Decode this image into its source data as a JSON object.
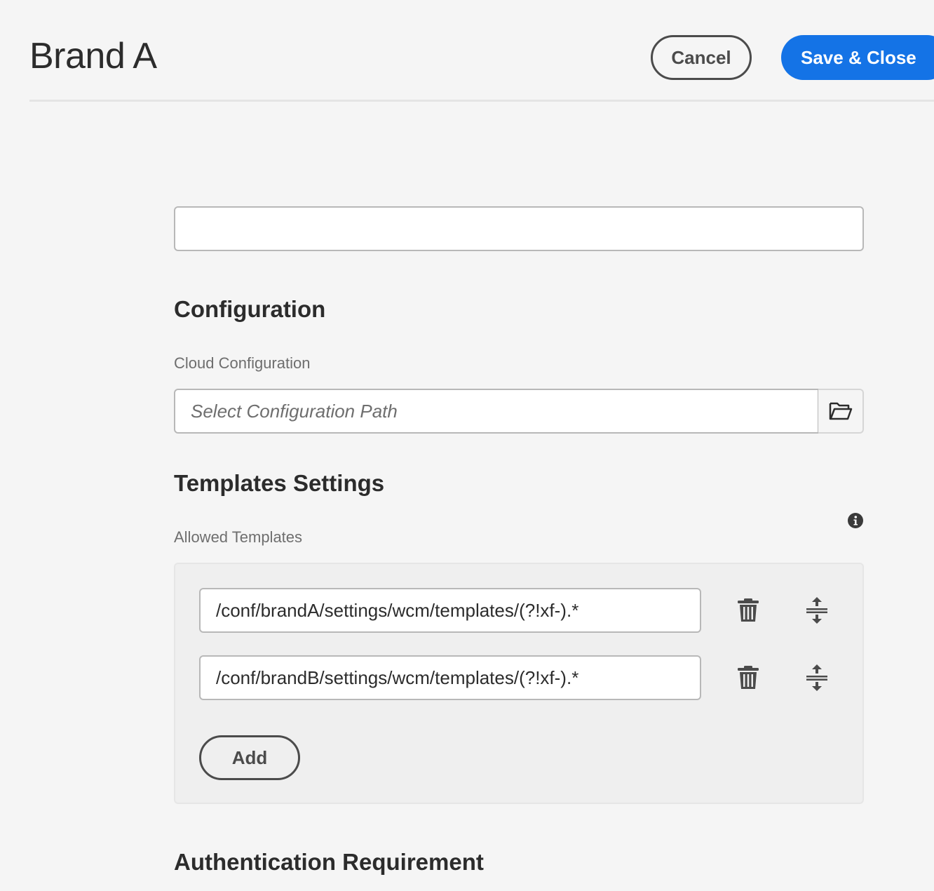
{
  "header": {
    "title": "Brand A",
    "cancel_label": "Cancel",
    "save_label": "Save & Close"
  },
  "form": {
    "title_field": {
      "value": "",
      "placeholder": ""
    },
    "configuration": {
      "heading": "Configuration",
      "cloud_config_label": "Cloud Configuration",
      "cloud_config_placeholder": "Select Configuration Path",
      "browse_icon": "folder-open-icon"
    },
    "templates": {
      "heading": "Templates Settings",
      "allowed_label": "Allowed Templates",
      "info_icon": "info-icon",
      "items": [
        {
          "value": "/conf/brandA/settings/wcm/templates/(?!xf-).*"
        },
        {
          "value": "/conf/brandB/settings/wcm/templates/(?!xf-).*"
        }
      ],
      "add_label": "Add"
    },
    "authentication": {
      "heading": "Authentication Requirement"
    }
  },
  "colors": {
    "accent": "#1473e6",
    "background": "#f5f5f5",
    "text": "#2c2c2c"
  }
}
